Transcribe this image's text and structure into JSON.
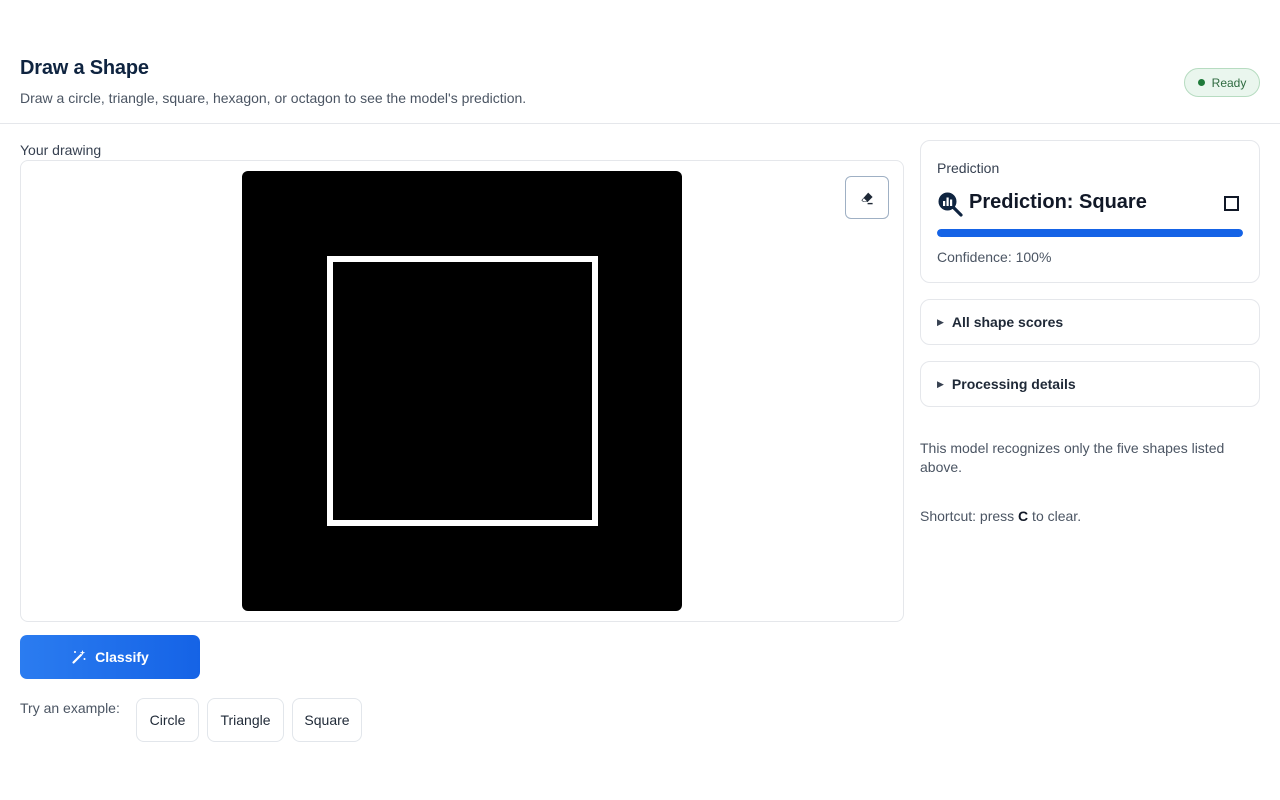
{
  "header": {
    "title": "Draw a Shape",
    "subtitle": "Draw a circle, triangle, square, hexagon, or octagon to see the model's prediction.",
    "status": "Ready"
  },
  "drawing": {
    "label": "Your drawing",
    "clear_icon": "eraser-icon"
  },
  "actions": {
    "classify_label": "Classify",
    "classify_icon": "magic-wand-icon",
    "examples_label": "Try an example:",
    "examples": [
      "Circle",
      "Triangle",
      "Square"
    ]
  },
  "prediction": {
    "card_label": "Prediction",
    "text": "Prediction: Square",
    "icon": "search-chart-icon",
    "shape_icon": "square-icon",
    "confidence_fraction": 1.0,
    "confidence_text": "Confidence: 100%"
  },
  "accordions": [
    {
      "label": "All shape scores"
    },
    {
      "label": "Processing details"
    }
  ],
  "note": "This model recognizes only the five shapes listed above.",
  "shortcut": {
    "prefix": "Shortcut: press ",
    "key": "C",
    "suffix": " to clear."
  },
  "colors": {
    "accent": "#1563e6",
    "status_dot": "#1f7a3a",
    "canvas_bg": "#000000",
    "stroke": "#ffffff"
  }
}
